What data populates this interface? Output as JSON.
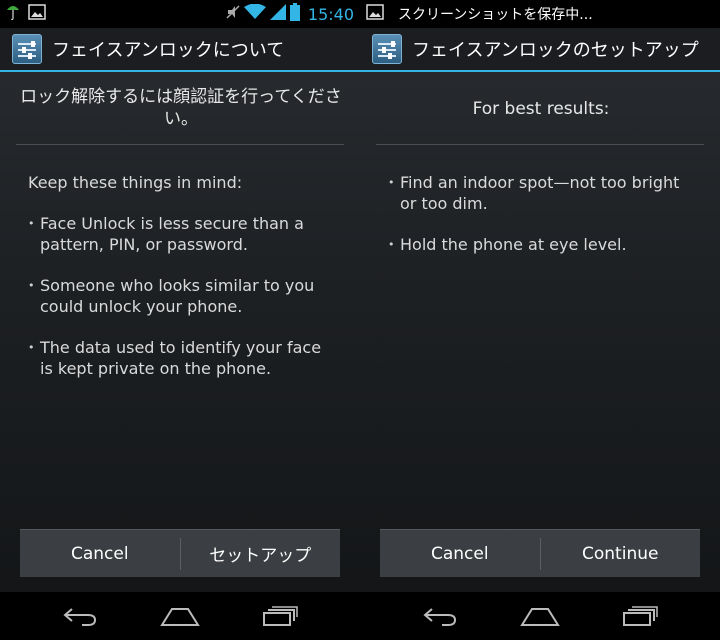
{
  "left": {
    "status": {
      "time": "15:40"
    },
    "action_bar_title": "フェイスアンロックについて",
    "header": "ロック解除するには顔認証を行ってください。",
    "intro": "Keep these things in mind:",
    "bullets": [
      "Face Unlock is less secure than a pattern, PIN, or password.",
      "Someone who looks similar to you could unlock your phone.",
      "The data used to identify your face is kept private on the phone."
    ],
    "buttons": {
      "cancel": "Cancel",
      "primary": "セットアップ"
    }
  },
  "right": {
    "status": {
      "notification": "スクリーンショットを保存中..."
    },
    "action_bar_title": "フェイスアンロックのセットアップ",
    "header": "For best results:",
    "bullets": [
      "Find an indoor spot—not too bright or too dim.",
      "Hold the phone at eye level."
    ],
    "buttons": {
      "cancel": "Cancel",
      "primary": "Continue"
    }
  },
  "icons": {
    "status_left": [
      "android-icon",
      "image-icon"
    ],
    "status_right": [
      "mute-icon",
      "wifi-icon",
      "signal-icon",
      "battery-icon"
    ],
    "nav": [
      "back-icon",
      "home-icon",
      "recent-apps-icon"
    ]
  },
  "colors": {
    "accent": "#33b5e5",
    "button_bar": "#3b3e42"
  }
}
